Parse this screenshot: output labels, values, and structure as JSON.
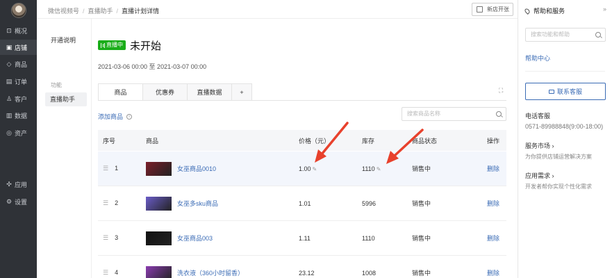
{
  "nav": {
    "items": [
      {
        "label": "概况",
        "icon": "overview-icon",
        "glyph": "⊡"
      },
      {
        "label": "店铺",
        "icon": "store-icon",
        "glyph": "▣",
        "active": true
      },
      {
        "label": "商品",
        "icon": "tag-icon",
        "glyph": "◇"
      },
      {
        "label": "订单",
        "icon": "order-icon",
        "glyph": "▤"
      },
      {
        "label": "客户",
        "icon": "customer-icon",
        "glyph": "♙"
      },
      {
        "label": "数据",
        "icon": "data-icon",
        "glyph": "▥"
      },
      {
        "label": "资产",
        "icon": "asset-icon",
        "glyph": "◎"
      }
    ],
    "bottom_items": [
      {
        "label": "应用",
        "icon": "apps-icon",
        "glyph": "✣"
      },
      {
        "label": "设置",
        "icon": "settings-icon",
        "glyph": "⚙"
      }
    ]
  },
  "breadcrumb": {
    "items": [
      "微信视频号",
      "直播助手",
      "直播计划详情"
    ],
    "sep": "/"
  },
  "topbar": {
    "new_shop_label": "新店开张"
  },
  "sidebar": {
    "title": "开通说明",
    "group_label": "功能",
    "item_label": "直播助手"
  },
  "plan": {
    "badge": "直播中",
    "status": "未开始",
    "date_range": "2021-03-06 00:00 至 2021-03-07 00:00"
  },
  "tabs": {
    "items": [
      "商品",
      "优惠券",
      "直播数据",
      "+"
    ],
    "active": 0
  },
  "products": {
    "add_label": "添加商品",
    "info_glyph": "i",
    "search_placeholder": "搜索商品名称",
    "headers": [
      "序号",
      "商品",
      "价格（元）",
      "库存",
      "商品状态",
      "操作"
    ],
    "rows": [
      {
        "seq": "1",
        "name": "女巫商品0010",
        "price": "1.00",
        "stock": "1110",
        "status": "销售中",
        "op": "删除",
        "thumb": "#7a1f2a",
        "editable": true
      },
      {
        "seq": "2",
        "name": "女巫多sku商品",
        "price": "1.01",
        "stock": "5996",
        "status": "销售中",
        "op": "删除",
        "thumb": "#6a5cc8",
        "editable": false
      },
      {
        "seq": "3",
        "name": "女巫商品003",
        "price": "1.11",
        "stock": "1110",
        "status": "销售中",
        "op": "删除",
        "thumb": "#111111",
        "editable": false
      },
      {
        "seq": "4",
        "name": "洗衣液（360小时留香）",
        "price": "23.12",
        "stock": "1008",
        "status": "销售中",
        "op": "删除",
        "thumb": "#8a3cb0",
        "editable": false
      }
    ]
  },
  "help": {
    "title": "帮助和服务",
    "collapse_glyph": "»",
    "search_placeholder": "搜索功能和帮助",
    "center_link": "帮助中心",
    "contact_label": "联系客服",
    "phone_label": "电话客服",
    "phone_value": "0571-89988848(9:00-18:00)",
    "market_label": "服务市场 ›",
    "market_desc": "为你提供店铺运营解决方案",
    "need_label": "应用需求 ›",
    "need_desc": "开发者帮你实现个性化需求"
  },
  "colors": {
    "accent": "#3a6bb5",
    "live": "#1aad19",
    "arrow": "#e8412c",
    "nav_bg": "#2f3237"
  }
}
